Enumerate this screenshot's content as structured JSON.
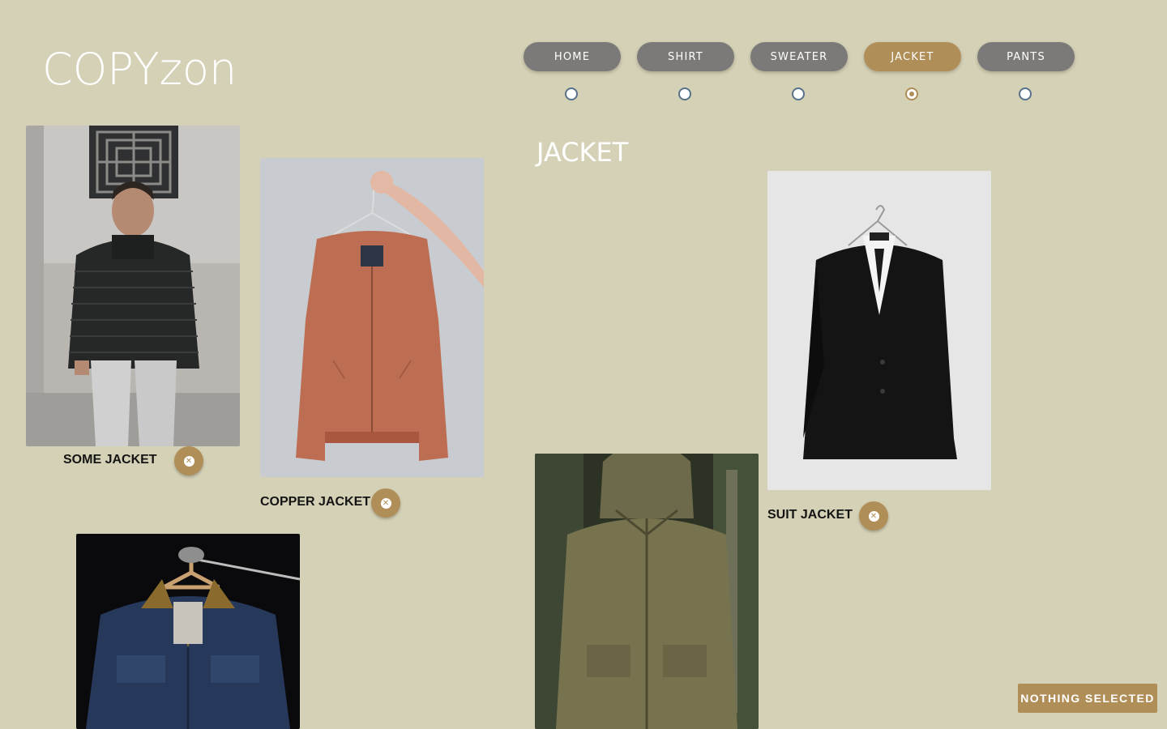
{
  "logo": {
    "text": "COPYzon"
  },
  "nav": {
    "items": [
      {
        "label": "HOME"
      },
      {
        "label": "SHIRT"
      },
      {
        "label": "SWEATER"
      },
      {
        "label": "JACKET"
      },
      {
        "label": "PANTS"
      }
    ],
    "active": "JACKET"
  },
  "section": {
    "title": "JACKET"
  },
  "products": [
    {
      "label": "SOME JACKET",
      "image": "man-black-puffer-jacket-photo"
    },
    {
      "label": "COPPER JACKET",
      "image": "copper-bomber-jacket-on-hanger-photo"
    },
    {
      "label": "SUIT JACKET",
      "image": "black-suit-jacket-on-hanger-photo"
    },
    {
      "label": "",
      "image": "man-olive-hooded-parka-photo"
    },
    {
      "label": "",
      "image": "denim-jacket-on-hanger-photo"
    }
  ],
  "status": {
    "label": "NOTHING SELECTED"
  },
  "colors": {
    "background": "#d5d1b6",
    "nav_inactive": "#7c7a78",
    "accent": "#b08e58",
    "radio_border": "#587289"
  },
  "icons": {
    "remove": "close-circle-icon"
  }
}
